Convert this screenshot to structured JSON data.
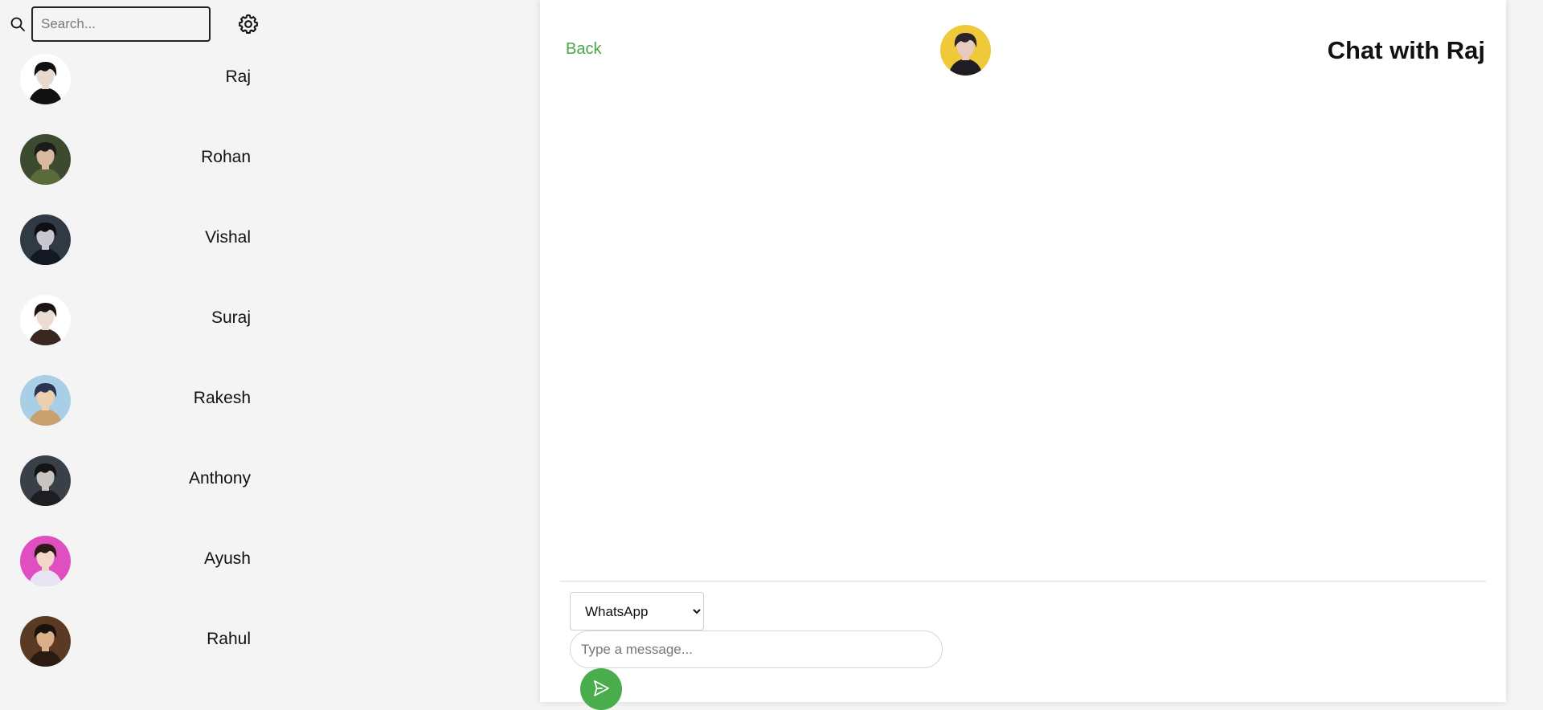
{
  "sidebar": {
    "search": {
      "placeholder": "Search...",
      "value": ""
    },
    "contacts": [
      {
        "name": "Raj",
        "avatar": "avatar-raj",
        "bg": "#ffffff",
        "hair": "#111111",
        "skin": "#e8d9cf",
        "cloth": "#111111"
      },
      {
        "name": "Rohan",
        "avatar": "avatar-rohan",
        "bg": "#3c4a2f",
        "hair": "#1c1c1c",
        "skin": "#d8b9a0",
        "cloth": "#5a6b3a"
      },
      {
        "name": "Vishal",
        "avatar": "avatar-vishal",
        "bg": "#2f3a45",
        "hair": "#0d0f14",
        "skin": "#c9c6cf",
        "cloth": "#141820"
      },
      {
        "name": "Suraj",
        "avatar": "avatar-suraj",
        "bg": "#ffffff",
        "hair": "#1a1412",
        "skin": "#eadcd2",
        "cloth": "#3a2620"
      },
      {
        "name": "Rakesh",
        "avatar": "avatar-rakesh",
        "bg": "#a9cfe6",
        "hair": "#2c3550",
        "skin": "#f0cfae",
        "cloth": "#c9a070"
      },
      {
        "name": "Anthony",
        "avatar": "avatar-anthony",
        "bg": "#3a4048",
        "hair": "#141414",
        "skin": "#c8c4c2",
        "cloth": "#1c1e22"
      },
      {
        "name": "Ayush",
        "avatar": "avatar-ayush",
        "bg": "#e04fc0",
        "hair": "#2b1a1a",
        "skin": "#f2d7c8",
        "cloth": "#e9e4f3"
      },
      {
        "name": "Rahul",
        "avatar": "avatar-rahul",
        "bg": "#5b3a24",
        "hair": "#1a120c",
        "skin": "#d9b08a",
        "cloth": "#2a1a10"
      }
    ]
  },
  "chat": {
    "back_label": "Back",
    "title": "Chat with Raj",
    "header_avatar": {
      "avatar": "avatar-raj-header",
      "bg": "#f0c93a",
      "hair": "#2a2428",
      "skin": "#e7cbc0",
      "cloth": "#1f1c24"
    },
    "platform": {
      "selected": "WhatsApp",
      "options": [
        "WhatsApp"
      ]
    },
    "message_input": {
      "placeholder": "Type a message...",
      "value": ""
    },
    "send_icon": "send-icon"
  },
  "colors": {
    "accent": "#45a748",
    "send_button": "#49ad4c",
    "sidebar_bg": "#f4f4f4",
    "panel_bg": "#ffffff"
  }
}
